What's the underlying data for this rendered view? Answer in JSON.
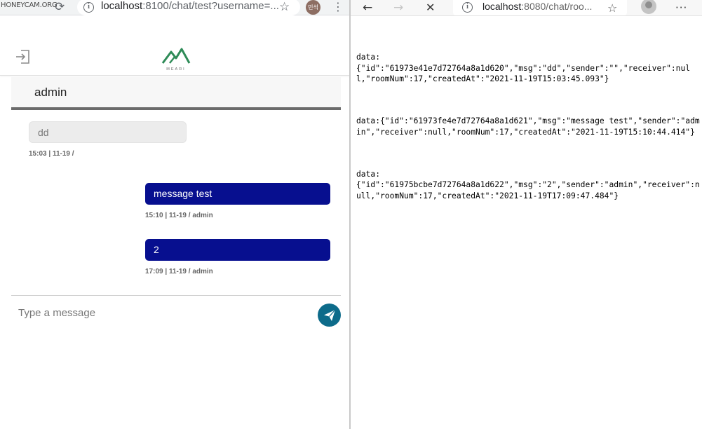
{
  "left_browser": {
    "watermark": "HONEYCAM.ORG",
    "address_host": "localhost",
    "address_rest": ":8100/chat/test?username=...",
    "profile_initials": "민석",
    "icons": {
      "reload": "reload-icon",
      "info": "info-icon",
      "star": "bookmark-star-icon",
      "menu": "kebab-menu-icon"
    }
  },
  "app": {
    "logo_text": "MEARI",
    "logo_color": "#2e8b57",
    "chat_title": "admin",
    "messages": [
      {
        "side": "left",
        "text": "dd",
        "time": "15:03",
        "date": "11-19",
        "sender": ""
      },
      {
        "side": "right",
        "text": "message test",
        "time": "15:10",
        "date": "11-19",
        "sender": "admin"
      },
      {
        "side": "right",
        "text": "2",
        "time": "17:09",
        "date": "11-19",
        "sender": "admin"
      }
    ],
    "input_placeholder": "Type a message",
    "colors": {
      "bubble_right": "#070f8f",
      "send_button": "#0d6b8a"
    }
  },
  "right_browser": {
    "address_host": "localhost",
    "address_rest": ":8080/chat/roo...",
    "events": [
      "data:\n{\"id\":\"61973e41e7d72764a8a1d620\",\"msg\":\"dd\",\"sender\":\"\",\"receiver\":null,\"roomNum\":17,\"createdAt\":\"2021-11-19T15:03:45.093\"}",
      "data:{\"id\":\"61973fe4e7d72764a8a1d621\",\"msg\":\"message test\",\"sender\":\"admin\",\"receiver\":null,\"roomNum\":17,\"createdAt\":\"2021-11-19T15:10:44.414\"}",
      "data:\n{\"id\":\"61975bcbe7d72764a8a1d622\",\"msg\":\"2\",\"sender\":\"admin\",\"receiver\":null,\"roomNum\":17,\"createdAt\":\"2021-11-19T17:09:47.484\"}"
    ]
  }
}
